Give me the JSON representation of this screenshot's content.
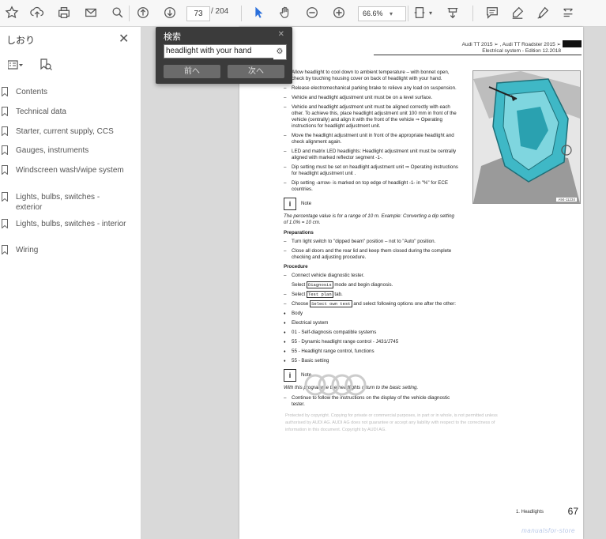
{
  "toolbar": {
    "page_current": "73",
    "page_total": "/ 204",
    "zoom": "66.6%",
    "icons": [
      "bookmark-star-icon",
      "upload-icon",
      "print-icon",
      "email-icon",
      "zoom-search-icon",
      "page-up-icon",
      "page-down-icon",
      "select-cursor-icon",
      "hand-icon",
      "zoom-out-icon",
      "zoom-in-icon",
      "fit-page-icon",
      "scroll-mode-icon",
      "comment-icon",
      "highlight-pen-icon",
      "sign-icon",
      "more-icon"
    ]
  },
  "sidebar": {
    "title": "しおり",
    "items": [
      {
        "label": "Contents"
      },
      {
        "label": "Technical data"
      },
      {
        "label": "Starter, current supply, CCS"
      },
      {
        "label": "Gauges, instruments"
      },
      {
        "label": "Windscreen wash/wipe system"
      },
      {
        "label": "Lights, bulbs, switches - exterior"
      },
      {
        "label": "Lights, bulbs, switches - interior"
      },
      {
        "label": "Wiring"
      }
    ]
  },
  "search": {
    "title": "検索",
    "value": "headlight with your hand",
    "prev_label": "前へ",
    "next_label": "次へ"
  },
  "document": {
    "header_line1": "Audi TT 2015 ➢ , Audi TT Roadster 2015 ➢",
    "header_line2": "Electrical system - Edition 12.2018",
    "footer": "1. Headlights",
    "page_number": "67",
    "watermark": "manualsfor-store",
    "figure_caption": "A94-11234",
    "para": {
      "b1": "Allow headlight to cool down to ambient temperature – with bonnet open, check by touching housing cover on back of headlight with your hand.",
      "b2": "Release electromechanical parking brake to relieve any load on suspension.",
      "b3": "Vehicle and headlight adjustment unit must be on a level surface.",
      "b4": "Vehicle and headlight adjustment unit must be aligned correctly with each other. To achieve this, place headlight adjustment unit 100 mm in front of the vehicle (centrally) and align it with the front of the vehicle ⇒ Operating instructions for headlight adjustment unit.",
      "b5": "Move the headlight adjustment unit in front of the appropriate headlight and check alignment again.",
      "b6": "LED and matrix LED headlights: Headlight adjustment unit must be centrally aligned with marked reflector segment -1-.",
      "b7": "Dip setting must be set on headlight adjustment unit ⇒ Operating instructions for headlight adjustment unit .",
      "b8": "Dip setting -arrow- is marked on top edge of headlight -1- in \"%\" for ECE countries.",
      "note1_label": "Note",
      "note1_text": "The percentage value is for a range of 10 m. Example: Converting a dip setting of 1.0% = 10 cm.",
      "prep_heading": "Preparations",
      "p1": "Turn light switch to \"dipped beam\" position – not to \"Auto\" position.",
      "p2": "Close all doors and the rear lid and keep them closed during the complete checking and adjusting procedure.",
      "proc_heading": "Procedure",
      "s1": "Connect vehicle diagnostic tester.",
      "s2a": "Select",
      "s2b": "Diagnosis",
      "s2c": "mode and begin diagnosis.",
      "s3a": "Select",
      "s3b": "Test plan",
      "s3c": "tab.",
      "s4a": "Choose",
      "s4b": "Select own test",
      "s4c": "and select following options one after the other:",
      "d1": "Body",
      "d2": "Electrical system",
      "d3": "01 - Self-diagnosis compatible systems",
      "d4": "55 - Dynamic headlight range control - J431/J745",
      "d5": "55 - Headlight range control, functions",
      "d6": "55 - Basic setting",
      "copyright": "Protected by copyright. Copying for private or commercial purposes, in part or in whole, is not permitted unless authorised by AUDI AG. AUDI AG does not guarantee or accept any liability with respect to the correctness of information in this document. Copyright by AUDI AG.",
      "note2_label": "Note",
      "note2_text": "With this programme the headlights return to the basic setting.",
      "s5": "Continue to follow the instructions on the display of the vehicle diagnostic tester."
    }
  }
}
